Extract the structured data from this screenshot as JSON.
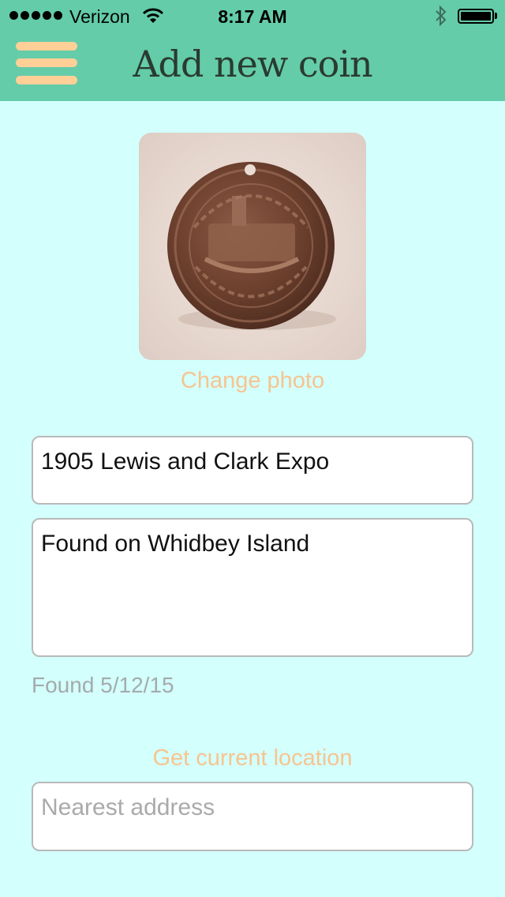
{
  "status_bar": {
    "carrier": "Verizon",
    "time": "8:17 AM",
    "battery_level": 1.0
  },
  "header": {
    "title": "Add new coin",
    "menu_icon": "hamburger-menu-icon"
  },
  "photo": {
    "change_label": "Change photo"
  },
  "form": {
    "name_value": "1905 Lewis and Clark Expo",
    "notes_value": "Found on Whidbey Island",
    "found_label": "Found 5/12/15",
    "location_button": "Get current location",
    "address_placeholder": "Nearest address"
  },
  "colors": {
    "header_bg": "#64cca9",
    "page_bg": "#d3fffd",
    "accent": "#f7c48e",
    "menu_bars": "#fecf97"
  }
}
